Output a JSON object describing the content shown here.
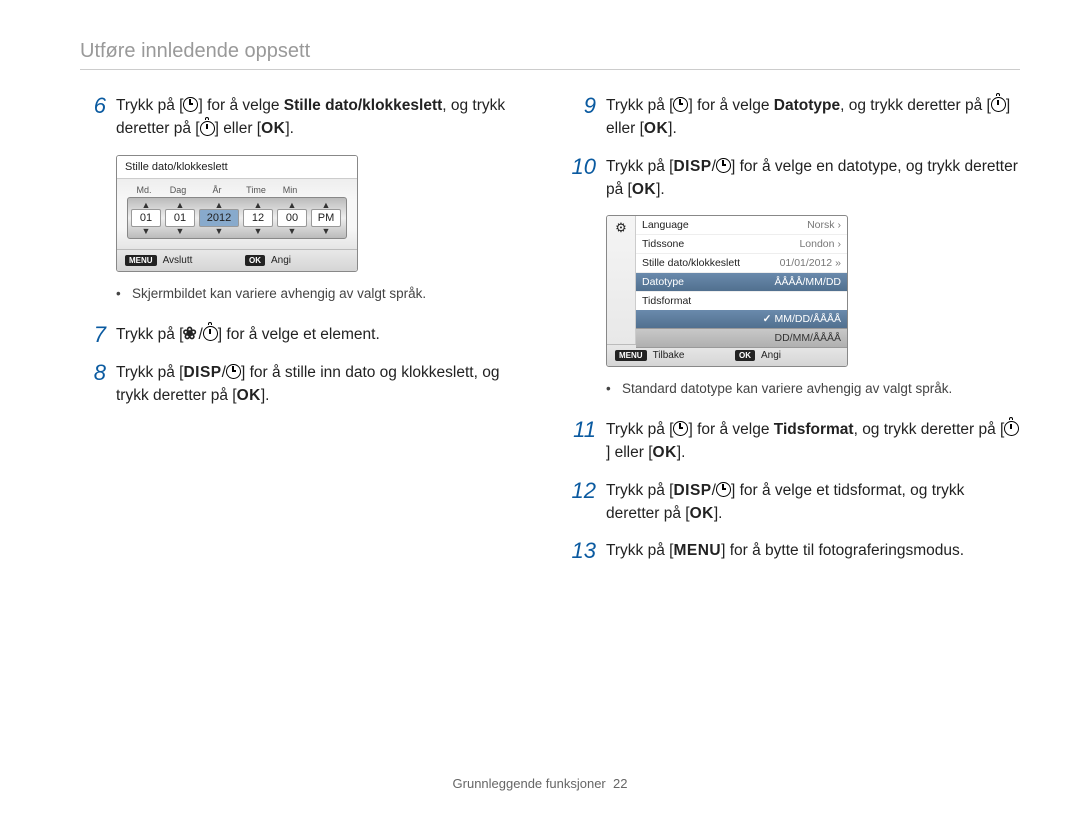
{
  "header": {
    "title": "Utføre innledende oppsett"
  },
  "footer": {
    "section": "Grunnleggende funksjoner",
    "page": "22"
  },
  "left": {
    "steps": [
      {
        "num": "6",
        "parts": [
          {
            "t": "Trykk på ["
          },
          {
            "icon": "timer"
          },
          {
            "t": "] for å velge "
          },
          {
            "t": "Stille dato/klokkeslett",
            "b": true
          },
          {
            "t": ", og trykk deretter på ["
          },
          {
            "icon": "selftimer"
          },
          {
            "t": "] eller ["
          },
          {
            "t": "OK",
            "cls": "btn-ok"
          },
          {
            "t": "]."
          }
        ]
      },
      {
        "num": "7",
        "parts": [
          {
            "t": "Trykk på ["
          },
          {
            "icon": "macro"
          },
          {
            "t": "/"
          },
          {
            "icon": "selftimer"
          },
          {
            "t": "] for å velge et element."
          }
        ]
      },
      {
        "num": "8",
        "parts": [
          {
            "t": "Trykk på ["
          },
          {
            "t": "DISP",
            "cls": "btn-disp"
          },
          {
            "t": "/"
          },
          {
            "icon": "timer"
          },
          {
            "t": "] for å stille inn dato og klokkeslett, og trykk deretter på ["
          },
          {
            "t": "OK",
            "cls": "btn-ok"
          },
          {
            "t": "]."
          }
        ]
      }
    ],
    "note": "Skjermbildet kan variere avhengig av valgt språk."
  },
  "right": {
    "steps": [
      {
        "num": "9",
        "parts": [
          {
            "t": "Trykk på ["
          },
          {
            "icon": "timer"
          },
          {
            "t": "] for å velge "
          },
          {
            "t": "Datotype",
            "b": true
          },
          {
            "t": ", og trykk deretter på ["
          },
          {
            "icon": "selftimer"
          },
          {
            "t": "] eller ["
          },
          {
            "t": "OK",
            "cls": "btn-ok"
          },
          {
            "t": "]."
          }
        ]
      },
      {
        "num": "10",
        "parts": [
          {
            "t": "Trykk på ["
          },
          {
            "t": "DISP",
            "cls": "btn-disp"
          },
          {
            "t": "/"
          },
          {
            "icon": "timer"
          },
          {
            "t": "] for å velge en datotype, og trykk deretter på ["
          },
          {
            "t": "OK",
            "cls": "btn-ok"
          },
          {
            "t": "]."
          }
        ]
      },
      {
        "num": "11",
        "parts": [
          {
            "t": "Trykk på ["
          },
          {
            "icon": "timer"
          },
          {
            "t": "] for å velge "
          },
          {
            "t": "Tidsformat",
            "b": true
          },
          {
            "t": ", og trykk deretter på ["
          },
          {
            "icon": "selftimer"
          },
          {
            "t": "] eller ["
          },
          {
            "t": "OK",
            "cls": "btn-ok"
          },
          {
            "t": "]."
          }
        ]
      },
      {
        "num": "12",
        "parts": [
          {
            "t": "Trykk på ["
          },
          {
            "t": "DISP",
            "cls": "btn-disp"
          },
          {
            "t": "/"
          },
          {
            "icon": "timer"
          },
          {
            "t": "] for å velge et tidsformat, og trykk deretter på ["
          },
          {
            "t": "OK",
            "cls": "btn-ok"
          },
          {
            "t": "]."
          }
        ]
      },
      {
        "num": "13",
        "parts": [
          {
            "t": "Trykk på ["
          },
          {
            "t": "MENU",
            "cls": "btn-menu"
          },
          {
            "t": "] for å bytte til fotograferingsmodus."
          }
        ]
      }
    ],
    "note": "Standard datotype kan variere avhengig av valgt språk."
  },
  "screen1": {
    "title": "Stille dato/klokkeslett",
    "headers": [
      "Md.",
      "Dag",
      "År",
      "Time",
      "Min",
      ""
    ],
    "values": [
      "01",
      "01",
      "2012",
      "12",
      "00",
      "PM"
    ],
    "foot": {
      "left": {
        "btn": "MENU",
        "label": "Avslutt"
      },
      "right": {
        "btn": "OK",
        "label": "Angi"
      }
    }
  },
  "screen2": {
    "side_icon": "⚙",
    "rows": [
      {
        "label": "Language",
        "val": "Norsk",
        "chev": "›"
      },
      {
        "label": "Tidssone",
        "val": "London",
        "chev": "›"
      },
      {
        "label": "Stille dato/klokkeslett",
        "val": "01/01/2012",
        "chev": "»"
      },
      {
        "label": "Datotype",
        "val": "ÅÅÅÅ/MM/DD",
        "hl": true
      },
      {
        "label": "Tidsformat",
        "val": ""
      }
    ],
    "options": [
      {
        "label": "MM/DD/ÅÅÅÅ",
        "sel": true
      },
      {
        "label": "DD/MM/ÅÅÅÅ"
      }
    ],
    "foot": {
      "left": {
        "btn": "MENU",
        "label": "Tilbake"
      },
      "right": {
        "btn": "OK",
        "label": "Angi"
      }
    }
  }
}
